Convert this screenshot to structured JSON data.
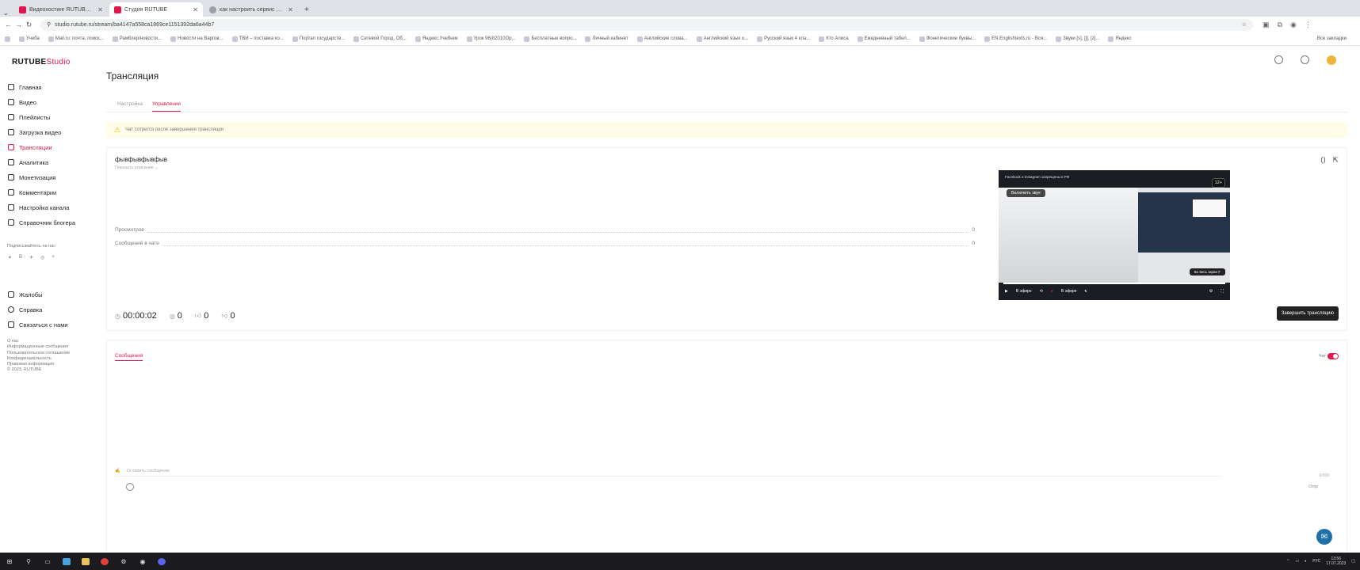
{
  "browser": {
    "tabs": [
      {
        "title": "Видеохостинг RUTUBE. Смотр...",
        "color": "#e0164d"
      },
      {
        "title": "Студия RUTUBE",
        "color": "#e0164d"
      },
      {
        "title": "как настроить сервис обса...",
        "color": "#9aa0a6"
      }
    ],
    "new_tab": "+",
    "url": "studio.rutube.ru/stream/ba4147a558ca1869ce1151392da6a44b7",
    "bookmarks": [
      "Учеба",
      "Mail.ru: почта, поиск...",
      "Рамблер/новости...",
      "Новости на Варгов...",
      "ТВИ – поставка ко...",
      "Портал государств...",
      "Сетевой Город. Об...",
      "Яндекс.Учебник",
      "Урок 96(82010Ор...",
      "Бесплатные вопро...",
      "Личный кабинет",
      "Английские словa...",
      "Английский язык о...",
      "Русский язык 4 кла...",
      "Кто Алиса",
      "Ежедневный табел...",
      "Фонетические буквы...",
      "EN Englishtexts.ru - Вся...",
      "Звуки [s], [ʃ], [z]...",
      "Яндекс"
    ],
    "all_bookmarks": "Все закладки"
  },
  "sidebar": {
    "logo_main": "RUTUBE",
    "logo_sub": "Studio",
    "items": [
      {
        "label": "Главная"
      },
      {
        "label": "Видео"
      },
      {
        "label": "Плейлисты"
      },
      {
        "label": "Загрузка видео"
      },
      {
        "label": "Трансляции"
      },
      {
        "label": "Аналитика"
      },
      {
        "label": "Монетизация"
      },
      {
        "label": "Комментарии"
      },
      {
        "label": "Настройка канала"
      },
      {
        "label": "Справочник блогера"
      }
    ],
    "subscribe_label": "Подписывайтесь на нас",
    "socials": [
      "✶",
      "В",
      "✈",
      "◎",
      "+"
    ],
    "bottom_items": [
      {
        "label": "Жалобы"
      },
      {
        "label": "Справка"
      },
      {
        "label": "Связаться с нами"
      }
    ],
    "footer_links": [
      "О нас",
      "Информационные сообщения",
      "Пользовательское соглашение",
      "Конфиденциальность",
      "Правовая информация",
      "© 2023, RUTUBE"
    ]
  },
  "page": {
    "title": "Трансляция",
    "tabs": [
      "Настройка",
      "Управление"
    ],
    "warning": "Чат сотрется после завершения трансляции"
  },
  "stream": {
    "title": "фывфывфывфыв",
    "subtitle": "Показать описание ⌄",
    "stats": [
      {
        "label": "Просмотров",
        "value": "0"
      },
      {
        "label": "Сообщений в чате",
        "value": "0"
      }
    ],
    "timer": "00:00:02",
    "viewers": "0",
    "likes": "0",
    "dislikes": "0",
    "end_button": "Завершить трансляцию"
  },
  "player": {
    "caption": "Facebook и Instagram запрещены в РФ",
    "age": "12+",
    "sound_button": "Включить звук",
    "fullscreen_hint": "Во весь экран  F",
    "live_label": "В эфире",
    "live_label2": "В эфире",
    "progress": 1.0
  },
  "messages": {
    "tab": "Сообщения",
    "chat_label": "Чат",
    "placeholder": "Оставить сообщение",
    "counter": "0/200",
    "send_label": "Отпр"
  },
  "taskbar": {
    "time": "13:56",
    "date": "17.07.2023",
    "lang": "РУС"
  }
}
